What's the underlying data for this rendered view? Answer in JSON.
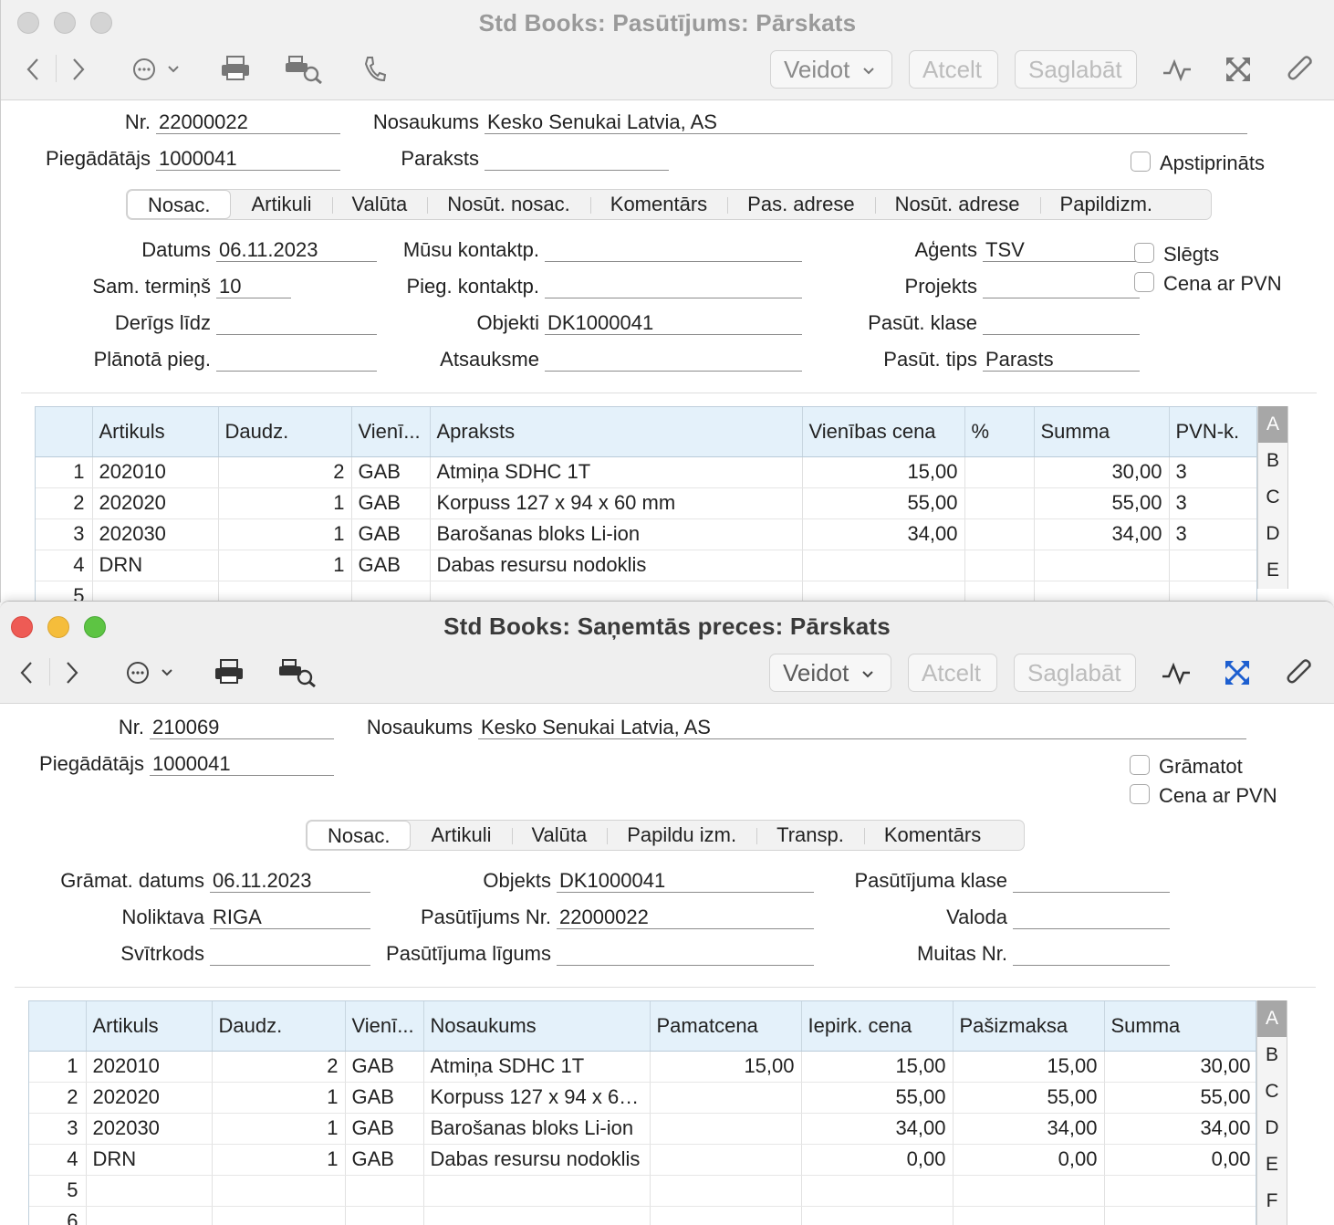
{
  "window1": {
    "title": "Std Books: Pasūtījums: Pārskats",
    "toolbar": {
      "veidot": "Veidot",
      "atcelt": "Atcelt",
      "saglabat": "Saglabāt"
    },
    "header": {
      "nr_label": "Nr.",
      "nr_value": "22000022",
      "nosaukums_label": "Nosaukums",
      "nosaukums_value": "Kesko Senukai Latvia, AS",
      "piegadatajs_label": "Piegādātājs",
      "piegadatajs_value": "1000041",
      "paraksts_label": "Paraksts",
      "paraksts_value": "",
      "apstiprinats_label": "Apstiprināts"
    },
    "tabs": [
      "Nosac.",
      "Artikuli",
      "Valūta",
      "Nosūt. nosac.",
      "Komentārs",
      "Pas. adrese",
      "Nosūt. adrese",
      "Papildizm."
    ],
    "fields": {
      "datums_label": "Datums",
      "datums_value": "06.11.2023",
      "samtermins_label": "Sam. termiņš",
      "samtermins_value": "10",
      "derigslidz_label": "Derīgs līdz",
      "derigslidz_value": "",
      "planota_label": "Plānotā pieg.",
      "planota_value": "",
      "musukontakt_label": "Mūsu kontaktp.",
      "musukontakt_value": "",
      "piegkontakt_label": "Pieg. kontaktp.",
      "piegkontakt_value": "",
      "objekti_label": "Objekti",
      "objekti_value": "DK1000041",
      "atsauksme_label": "Atsauksme",
      "atsauksme_value": "",
      "agents_label": "Aģents",
      "agents_value": "TSV",
      "projekts_label": "Projekts",
      "projekts_value": "",
      "pasklase_label": "Pasūt. klase",
      "pasklase_value": "",
      "pastips_label": "Pasūt. tips",
      "pastips_value": "Parasts",
      "slegts_label": "Slēgts",
      "cenapvn_label": "Cena ar PVN"
    },
    "grid": {
      "columns": [
        "",
        "Artikuls",
        "Daudz.",
        "Vienī...",
        "Apraksts",
        "Vienības cena",
        "%",
        "Summa",
        "PVN-k."
      ],
      "rows": [
        [
          "1",
          "202010",
          "2",
          "GAB",
          "Atmiņa SDHC 1T",
          "15,00",
          "",
          "30,00",
          "3"
        ],
        [
          "2",
          "202020",
          "1",
          "GAB",
          "Korpuss 127 x 94 x 60 mm",
          "55,00",
          "",
          "55,00",
          "3"
        ],
        [
          "3",
          "202030",
          "1",
          "GAB",
          "Barošanas bloks Li-ion",
          "34,00",
          "",
          "34,00",
          "3"
        ],
        [
          "4",
          "DRN",
          "1",
          "GAB",
          "Dabas resursu nodoklis",
          "",
          "",
          "",
          ""
        ],
        [
          "5",
          "",
          "",
          "",
          "",
          "",
          "",
          "",
          ""
        ]
      ],
      "side": [
        "A",
        "B",
        "C",
        "D",
        "E"
      ]
    }
  },
  "window2": {
    "title": "Std Books: Saņemtās preces: Pārskats",
    "toolbar": {
      "veidot": "Veidot",
      "atcelt": "Atcelt",
      "saglabat": "Saglabāt"
    },
    "header": {
      "nr_label": "Nr.",
      "nr_value": "210069",
      "nosaukums_label": "Nosaukums",
      "nosaukums_value": "Kesko Senukai Latvia, AS",
      "piegadatajs_label": "Piegādātājs",
      "piegadatajs_value": "1000041",
      "gramatot_label": "Grāmatot",
      "cenapvn_label": "Cena ar PVN"
    },
    "tabs": [
      "Nosac.",
      "Artikuli",
      "Valūta",
      "Papildu izm.",
      "Transp.",
      "Komentārs"
    ],
    "fields": {
      "gramdatums_label": "Grāmat. datums",
      "gramdatums_value": "06.11.2023",
      "noliktava_label": "Noliktava",
      "noliktava_value": "RIGA",
      "svitrkods_label": "Svītrkods",
      "svitrkods_value": "",
      "objekts_label": "Objekts",
      "objekts_value": "DK1000041",
      "pasnr_label": "Pasūtījums Nr.",
      "pasnr_value": "22000022",
      "paslig_label": "Pasūtījuma līgums",
      "paslig_value": "",
      "pasklase_label": "Pasūtījuma klase",
      "pasklase_value": "",
      "valoda_label": "Valoda",
      "valoda_value": "",
      "muitas_label": "Muitas Nr.",
      "muitas_value": ""
    },
    "grid": {
      "columns": [
        "",
        "Artikuls",
        "Daudz.",
        "Vienī...",
        "Nosaukums",
        "Pamatcena",
        "Iepirk. cena",
        "Pašizmaksa",
        "Summa"
      ],
      "rows": [
        [
          "1",
          "202010",
          "2",
          "GAB",
          "Atmiņa SDHC 1T",
          "15,00",
          "15,00",
          "15,00",
          "30,00"
        ],
        [
          "2",
          "202020",
          "1",
          "GAB",
          "Korpuss 127 x 94 x 6…",
          "",
          "55,00",
          "55,00",
          "55,00"
        ],
        [
          "3",
          "202030",
          "1",
          "GAB",
          "Barošanas bloks Li-ion",
          "",
          "34,00",
          "34,00",
          "34,00"
        ],
        [
          "4",
          "DRN",
          "1",
          "GAB",
          "Dabas resursu nodoklis",
          "",
          "0,00",
          "0,00",
          "0,00"
        ],
        [
          "5",
          "",
          "",
          "",
          "",
          "",
          "",
          "",
          ""
        ],
        [
          "6",
          "",
          "",
          "",
          "",
          "",
          "",
          "",
          ""
        ]
      ],
      "side": [
        "A",
        "B",
        "C",
        "D",
        "E",
        "F"
      ]
    }
  }
}
